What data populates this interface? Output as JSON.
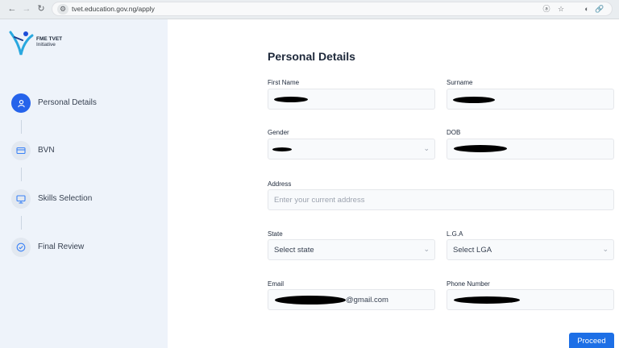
{
  "browser": {
    "back_icon": "arrow-left-icon",
    "forward_icon": "arrow-right-icon",
    "reload_icon": "reload-icon",
    "url": "tvet.education.gov.ng/apply"
  },
  "sidebar": {
    "logo_text_line1": "FME TVET",
    "logo_text_line2": "Initiative",
    "steps": [
      {
        "label": "Personal Details",
        "icon": "user-icon",
        "active": true
      },
      {
        "label": "BVN",
        "icon": "card-icon",
        "active": false
      },
      {
        "label": "Skills Selection",
        "icon": "monitor-icon",
        "active": false
      },
      {
        "label": "Final Review",
        "icon": "check-circle-icon",
        "active": false
      }
    ]
  },
  "form": {
    "title": "Personal Details",
    "first_name": {
      "label": "First Name",
      "value": ""
    },
    "surname": {
      "label": "Surname",
      "value": ""
    },
    "gender": {
      "label": "Gender",
      "value": ""
    },
    "dob": {
      "label": "DOB",
      "value": ""
    },
    "address": {
      "label": "Address",
      "placeholder": "Enter your current address"
    },
    "state": {
      "label": "State",
      "value": "Select state"
    },
    "lga": {
      "label": "L.G.A",
      "value": "Select LGA"
    },
    "email": {
      "label": "Email",
      "value_suffix": "@gmail.com"
    },
    "phone": {
      "label": "Phone Number",
      "value": ""
    },
    "proceed_label": "Proceed"
  },
  "colors": {
    "primary": "#2563eb",
    "sidebar_bg": "#eef3fa"
  }
}
